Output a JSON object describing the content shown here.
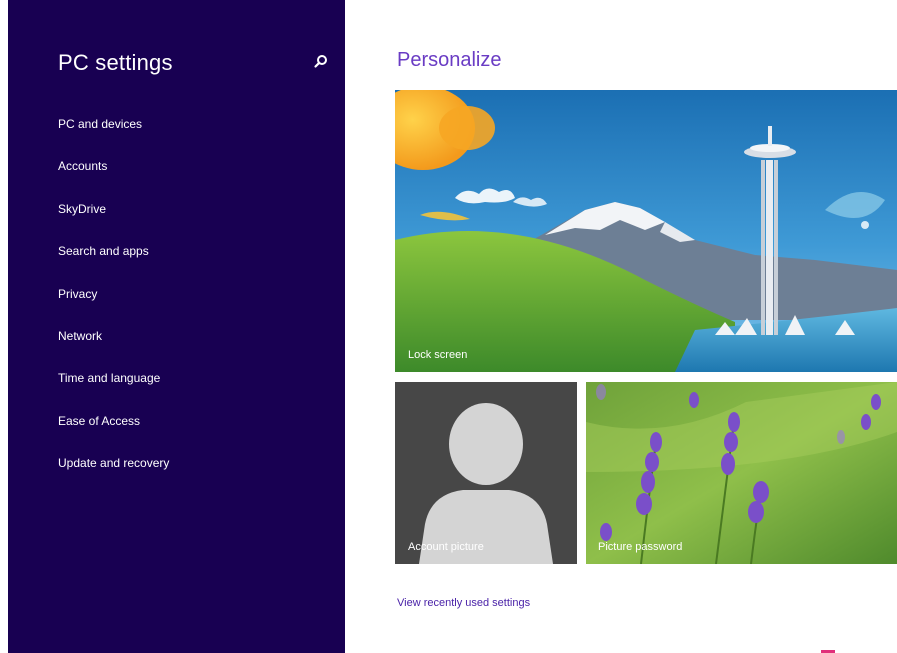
{
  "sidebar": {
    "title": "PC settings",
    "search_icon": "search-icon",
    "items": [
      {
        "label": "PC and devices"
      },
      {
        "label": "Accounts"
      },
      {
        "label": "SkyDrive"
      },
      {
        "label": "Search and apps"
      },
      {
        "label": "Privacy"
      },
      {
        "label": "Network"
      },
      {
        "label": "Time and language"
      },
      {
        "label": "Ease of Access"
      },
      {
        "label": "Update and recovery"
      }
    ]
  },
  "main": {
    "title": "Personalize",
    "tiles": {
      "lock_screen": {
        "label": "Lock screen"
      },
      "account_picture": {
        "label": "Account picture"
      },
      "picture_password": {
        "label": "Picture password"
      }
    },
    "recent_link": "View recently used settings"
  },
  "colors": {
    "sidebar_bg": "#180052",
    "accent": "#6a3cc4",
    "link": "#4a22a8",
    "account_tile_bg": "#474747"
  }
}
